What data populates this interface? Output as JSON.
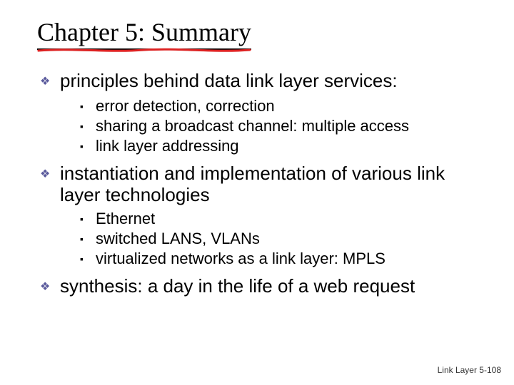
{
  "title": "Chapter 5: Summary",
  "items": [
    {
      "text": "principles behind data link layer services:",
      "sub": [
        "error detection, correction",
        "sharing a broadcast channel: multiple access",
        "link layer addressing"
      ]
    },
    {
      "text": "instantiation and implementation of various link layer technologies",
      "sub": [
        "Ethernet",
        "switched LANS, VLANs",
        "virtualized networks as a link layer: MPLS"
      ]
    },
    {
      "text": "synthesis: a day in the life of a web request",
      "sub": []
    }
  ],
  "footer": "Link Layer 5-108"
}
